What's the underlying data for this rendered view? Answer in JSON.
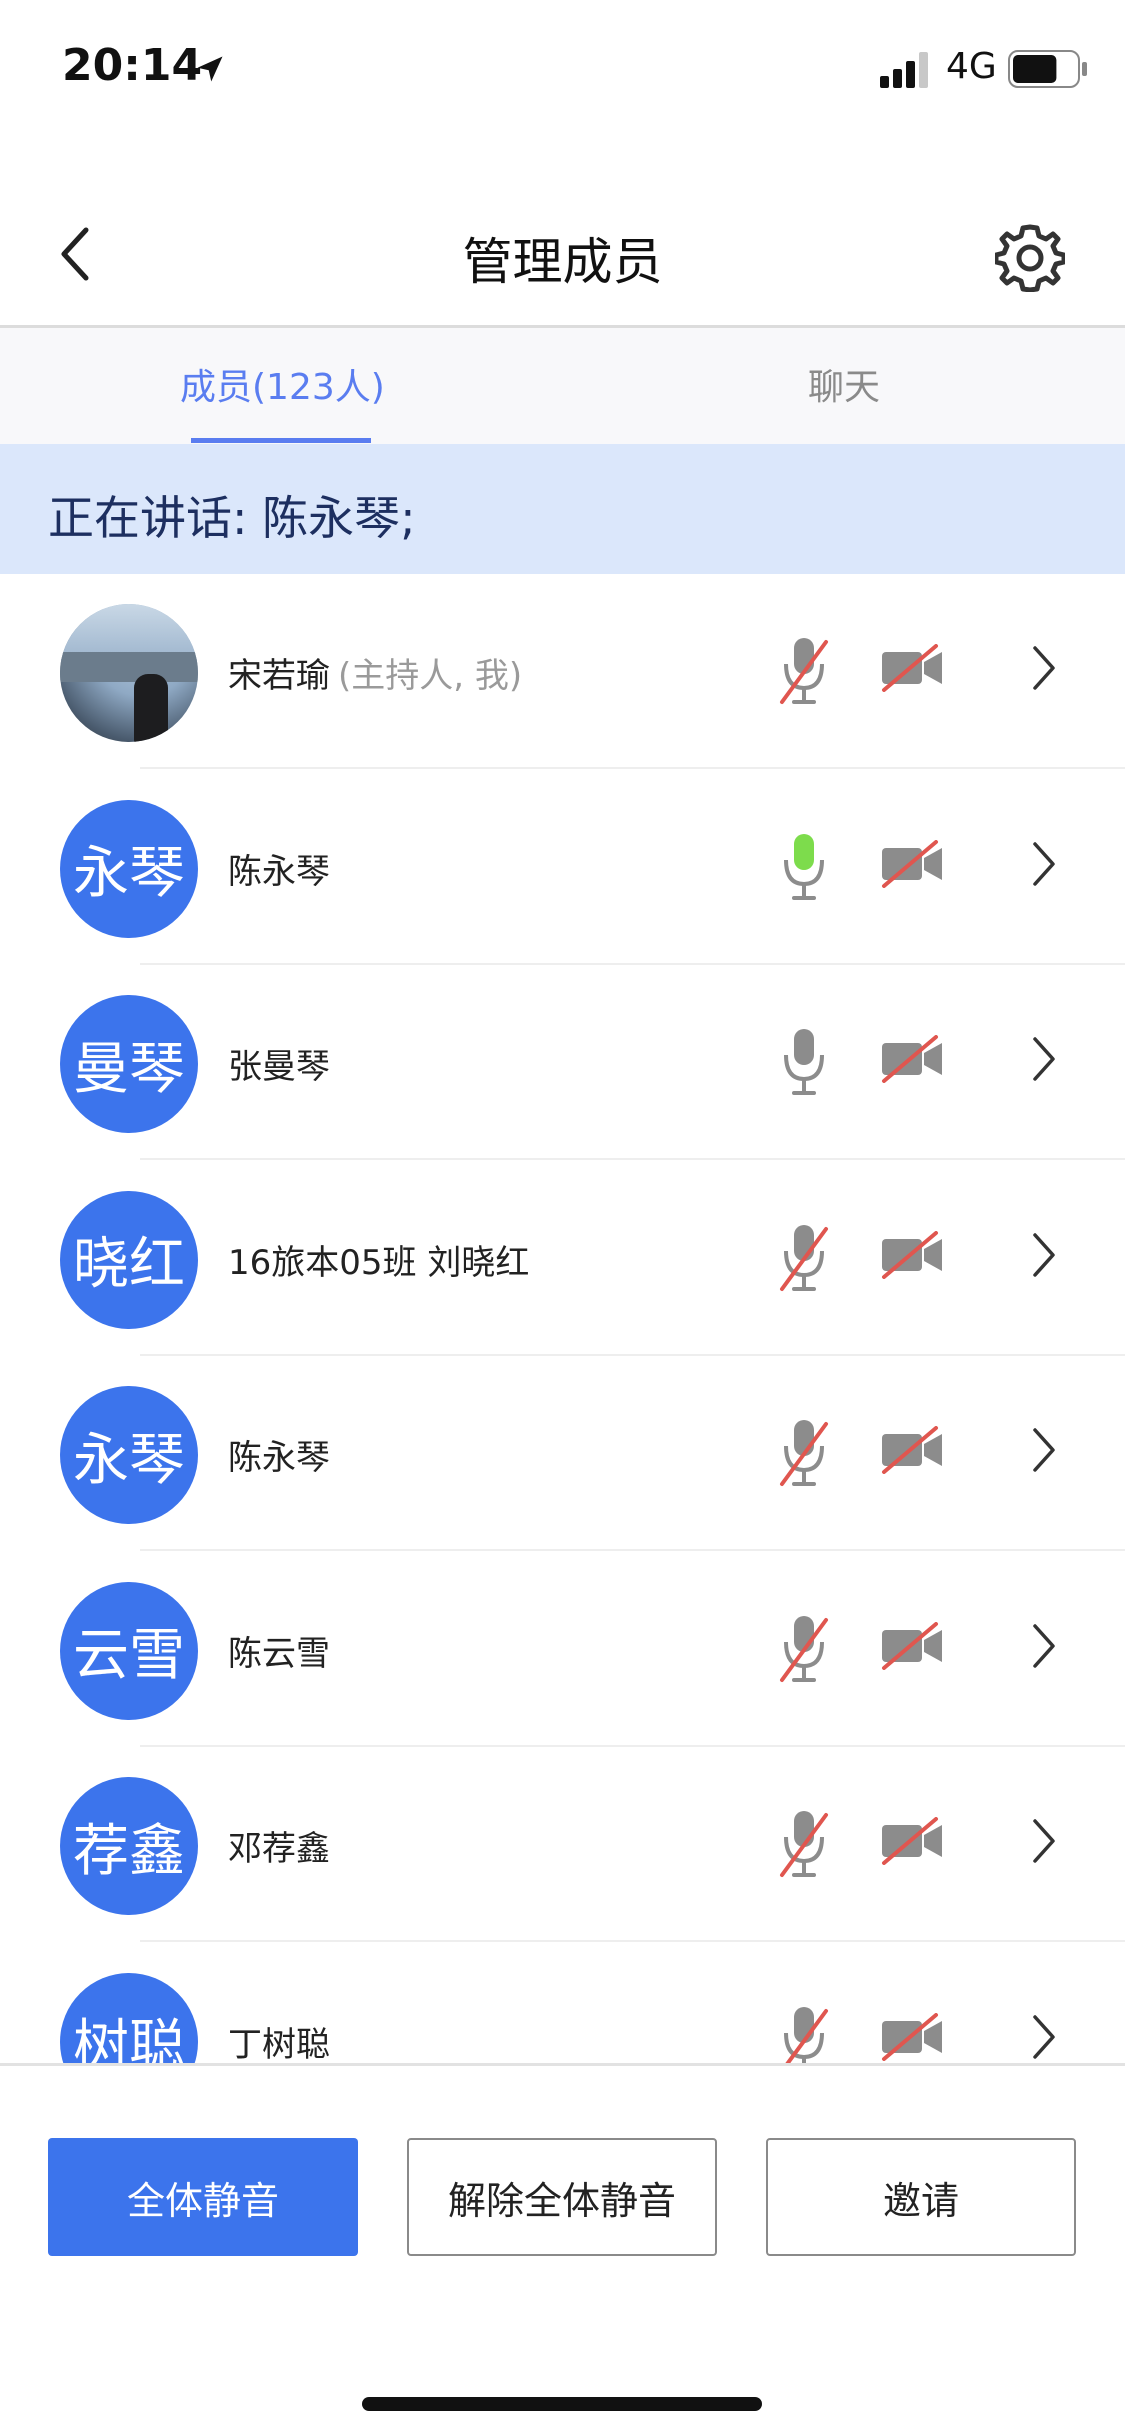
{
  "status_bar": {
    "time": "20:14",
    "network": "4G",
    "battery_percent": 70
  },
  "nav": {
    "title": "管理成员"
  },
  "tabs": [
    {
      "label": "成员(123人)",
      "active": true
    },
    {
      "label": "聊天",
      "active": false
    }
  ],
  "speaking": {
    "text": "正在讲话: 陈永琴;"
  },
  "members": [
    {
      "avatar_text": "",
      "avatar_type": "photo",
      "name": "宋若瑜",
      "role": "(主持人, 我)",
      "mic": "muted",
      "camera": "off"
    },
    {
      "avatar_text": "永琴",
      "avatar_type": "initials",
      "name": "陈永琴",
      "role": "",
      "mic": "active",
      "camera": "off"
    },
    {
      "avatar_text": "曼琴",
      "avatar_type": "initials",
      "name": "张曼琴",
      "role": "",
      "mic": "on",
      "camera": "off"
    },
    {
      "avatar_text": "晓红",
      "avatar_type": "initials",
      "name": "16旅本05班 刘晓红",
      "role": "",
      "mic": "muted",
      "camera": "off"
    },
    {
      "avatar_text": "永琴",
      "avatar_type": "initials",
      "name": "陈永琴",
      "role": "",
      "mic": "muted",
      "camera": "off"
    },
    {
      "avatar_text": "云雪",
      "avatar_type": "initials",
      "name": "陈云雪",
      "role": "",
      "mic": "muted",
      "camera": "off"
    },
    {
      "avatar_text": "荐鑫",
      "avatar_type": "initials",
      "name": "邓荐鑫",
      "role": "",
      "mic": "muted",
      "camera": "off"
    },
    {
      "avatar_text": "树聪",
      "avatar_type": "initials",
      "name": "丁树聪",
      "role": "",
      "mic": "muted",
      "camera": "off"
    }
  ],
  "buttons": {
    "mute_all": "全体静音",
    "unmute_all": "解除全体静音",
    "invite": "邀请"
  },
  "colors": {
    "accent": "#3c74ec",
    "tab_active": "#5a7df0",
    "mic_active": "#7ddc4c",
    "muted_slash": "#e0564f",
    "banner_bg": "#dbe7fb"
  }
}
